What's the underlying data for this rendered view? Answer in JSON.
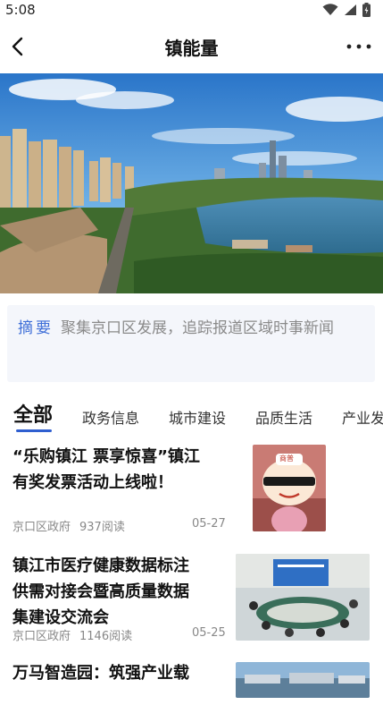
{
  "status_bar": {
    "time": "5:08"
  },
  "header": {
    "title": "镇能量"
  },
  "summary": {
    "label": "摘要",
    "text": "聚集京口区发展，追踪报道区域时事新闻"
  },
  "tabs": [
    {
      "label": "全部"
    },
    {
      "label": "政务信息"
    },
    {
      "label": "城市建设"
    },
    {
      "label": "品质生活"
    },
    {
      "label": "产业发"
    }
  ],
  "articles": [
    {
      "title_line1": "“乐购镇江 票享惊喜”镇江",
      "title_line2": "有奖发票活动上线啦！",
      "source": "京口区政府",
      "reads": "937阅读",
      "date": "05-27",
      "thumb_badge": "商普"
    },
    {
      "title_line1": "镇江市医疗健康数据标注",
      "title_line2": "供需对接会暨高质量数据",
      "title_line3": "集建设交流会",
      "source": "京口区政府",
      "reads": "1146阅读",
      "date": "05-25"
    },
    {
      "title_line1": "万马智造园：筑强产业载"
    }
  ],
  "colors": {
    "accent": "#2f5fd0",
    "summary_bg": "#f4f6fb"
  }
}
